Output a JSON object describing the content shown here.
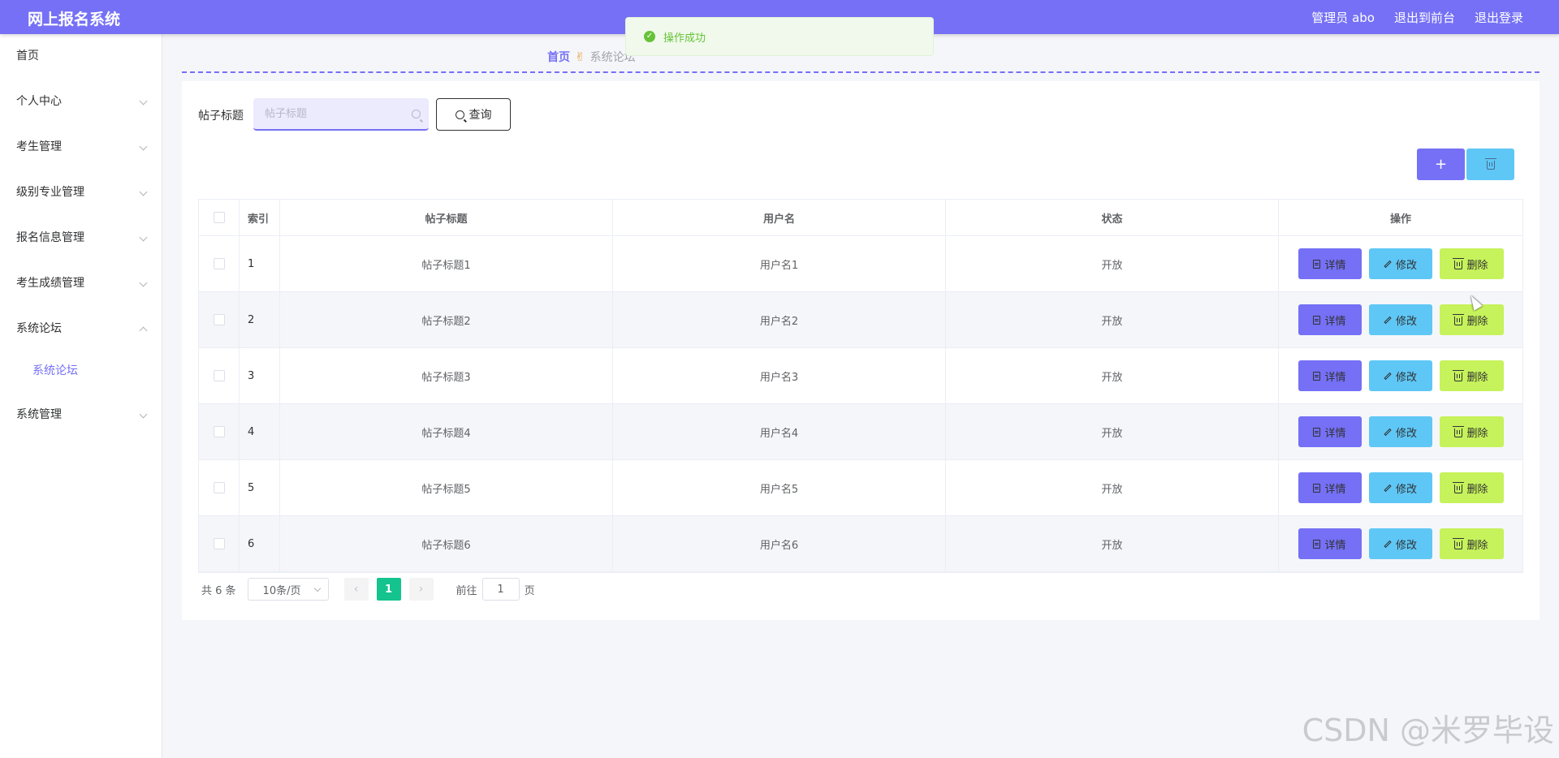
{
  "header": {
    "app_title": "网上报名系统",
    "user_label": "管理员 abo",
    "to_front_label": "退出到前台",
    "logout_label": "退出登录"
  },
  "sidebar": {
    "items": [
      {
        "label": "首页"
      },
      {
        "label": "个人中心"
      },
      {
        "label": "考生管理"
      },
      {
        "label": "级别专业管理"
      },
      {
        "label": "报名信息管理"
      },
      {
        "label": "考生成绩管理"
      },
      {
        "label": "系统论坛"
      },
      {
        "label": "系统管理"
      }
    ],
    "submenu_active": "系统论坛"
  },
  "breadcrumb": {
    "home": "首页",
    "separator_icon": "hand-icon",
    "current": "系统论坛"
  },
  "toast": {
    "message": "操作成功",
    "color": "#67c23a"
  },
  "search": {
    "label": "帖子标题",
    "placeholder": "帖子标题",
    "value": "",
    "button_label": "查询"
  },
  "toolbar": {
    "add_label": "+"
  },
  "table": {
    "headers": [
      "索引",
      "帖子标题",
      "用户名",
      "状态",
      "操作"
    ],
    "rows": [
      {
        "index": "1",
        "title": "帖子标题1",
        "user": "用户名1",
        "status": "开放"
      },
      {
        "index": "2",
        "title": "帖子标题2",
        "user": "用户名2",
        "status": "开放"
      },
      {
        "index": "3",
        "title": "帖子标题3",
        "user": "用户名3",
        "status": "开放"
      },
      {
        "index": "4",
        "title": "帖子标题4",
        "user": "用户名4",
        "status": "开放"
      },
      {
        "index": "5",
        "title": "帖子标题5",
        "user": "用户名5",
        "status": "开放"
      },
      {
        "index": "6",
        "title": "帖子标题6",
        "user": "用户名6",
        "status": "开放"
      }
    ],
    "actions": {
      "detail": "详情",
      "edit": "修改",
      "delete": "删除"
    }
  },
  "pagination": {
    "total_text": "共 6 条",
    "page_size": "10条/页",
    "prev": "‹",
    "next": "›",
    "current_page": "1",
    "goto_label": "前往",
    "goto_value": "1",
    "page_suffix": "页"
  },
  "watermark": "CSDN @米罗毕设",
  "colors": {
    "primary": "#7570f5",
    "info": "#5ec7f6",
    "danger_button": "#c6f25b",
    "pager_active": "#14c38e"
  }
}
